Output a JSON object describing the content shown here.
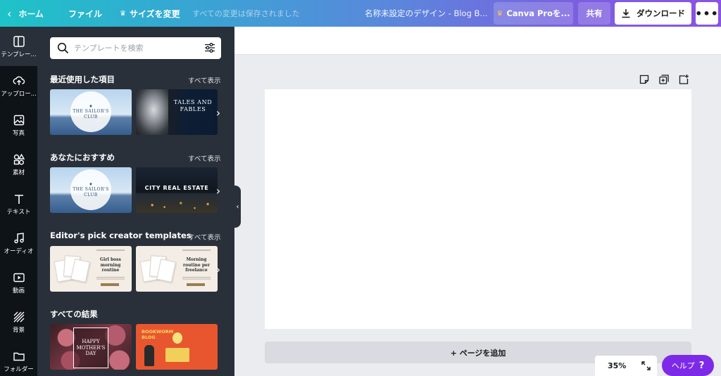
{
  "topbar": {
    "home_label": "ホーム",
    "file_label": "ファイル",
    "resize_label": "サイズを変更",
    "saved_status": "すべての変更は保存されました",
    "design_title": "名称未設定のデザイン - Blog B...",
    "pro_label": "Canva Proを...",
    "share_label": "共有",
    "download_label": "ダウンロード",
    "more_label": "•••"
  },
  "rail": {
    "items": [
      {
        "label": "テンプレー...",
        "icon": "template-icon"
      },
      {
        "label": "アップロー...",
        "icon": "upload-icon"
      },
      {
        "label": "写真",
        "icon": "photo-icon"
      },
      {
        "label": "素材",
        "icon": "elements-icon"
      },
      {
        "label": "テキスト",
        "icon": "text-icon"
      },
      {
        "label": "オーディオ",
        "icon": "audio-icon"
      },
      {
        "label": "動画",
        "icon": "video-icon"
      },
      {
        "label": "背景",
        "icon": "background-icon"
      },
      {
        "label": "フォルダー",
        "icon": "folder-icon"
      }
    ]
  },
  "panel": {
    "search_placeholder": "テンプレートを検索",
    "see_all": "すべて表示",
    "sections": [
      {
        "title": "最近使用した項目"
      },
      {
        "title": "あなたにおすすめ"
      },
      {
        "title": "Editor's pick creator templates"
      },
      {
        "title": "すべての結果"
      }
    ],
    "thumbs": {
      "sailor_title": "THE SAILOR'S\nCLUB",
      "tales_title": "TALES AND\nFABLES",
      "city_title": "CITY REAL ESTATE",
      "pick1_title": "Girl boss\nmorning\nroutine",
      "pick2_title": "Morning\nroutine per\nfreelance",
      "mother_title": "HAPPY\nMOTHER'S\nDAY",
      "book_title": "BOOKWORM\nBLOG"
    }
  },
  "editor": {
    "add_page_label": "+ ページを追加",
    "zoom": "35%",
    "help_label": "ヘルプ",
    "help_q": "?"
  }
}
